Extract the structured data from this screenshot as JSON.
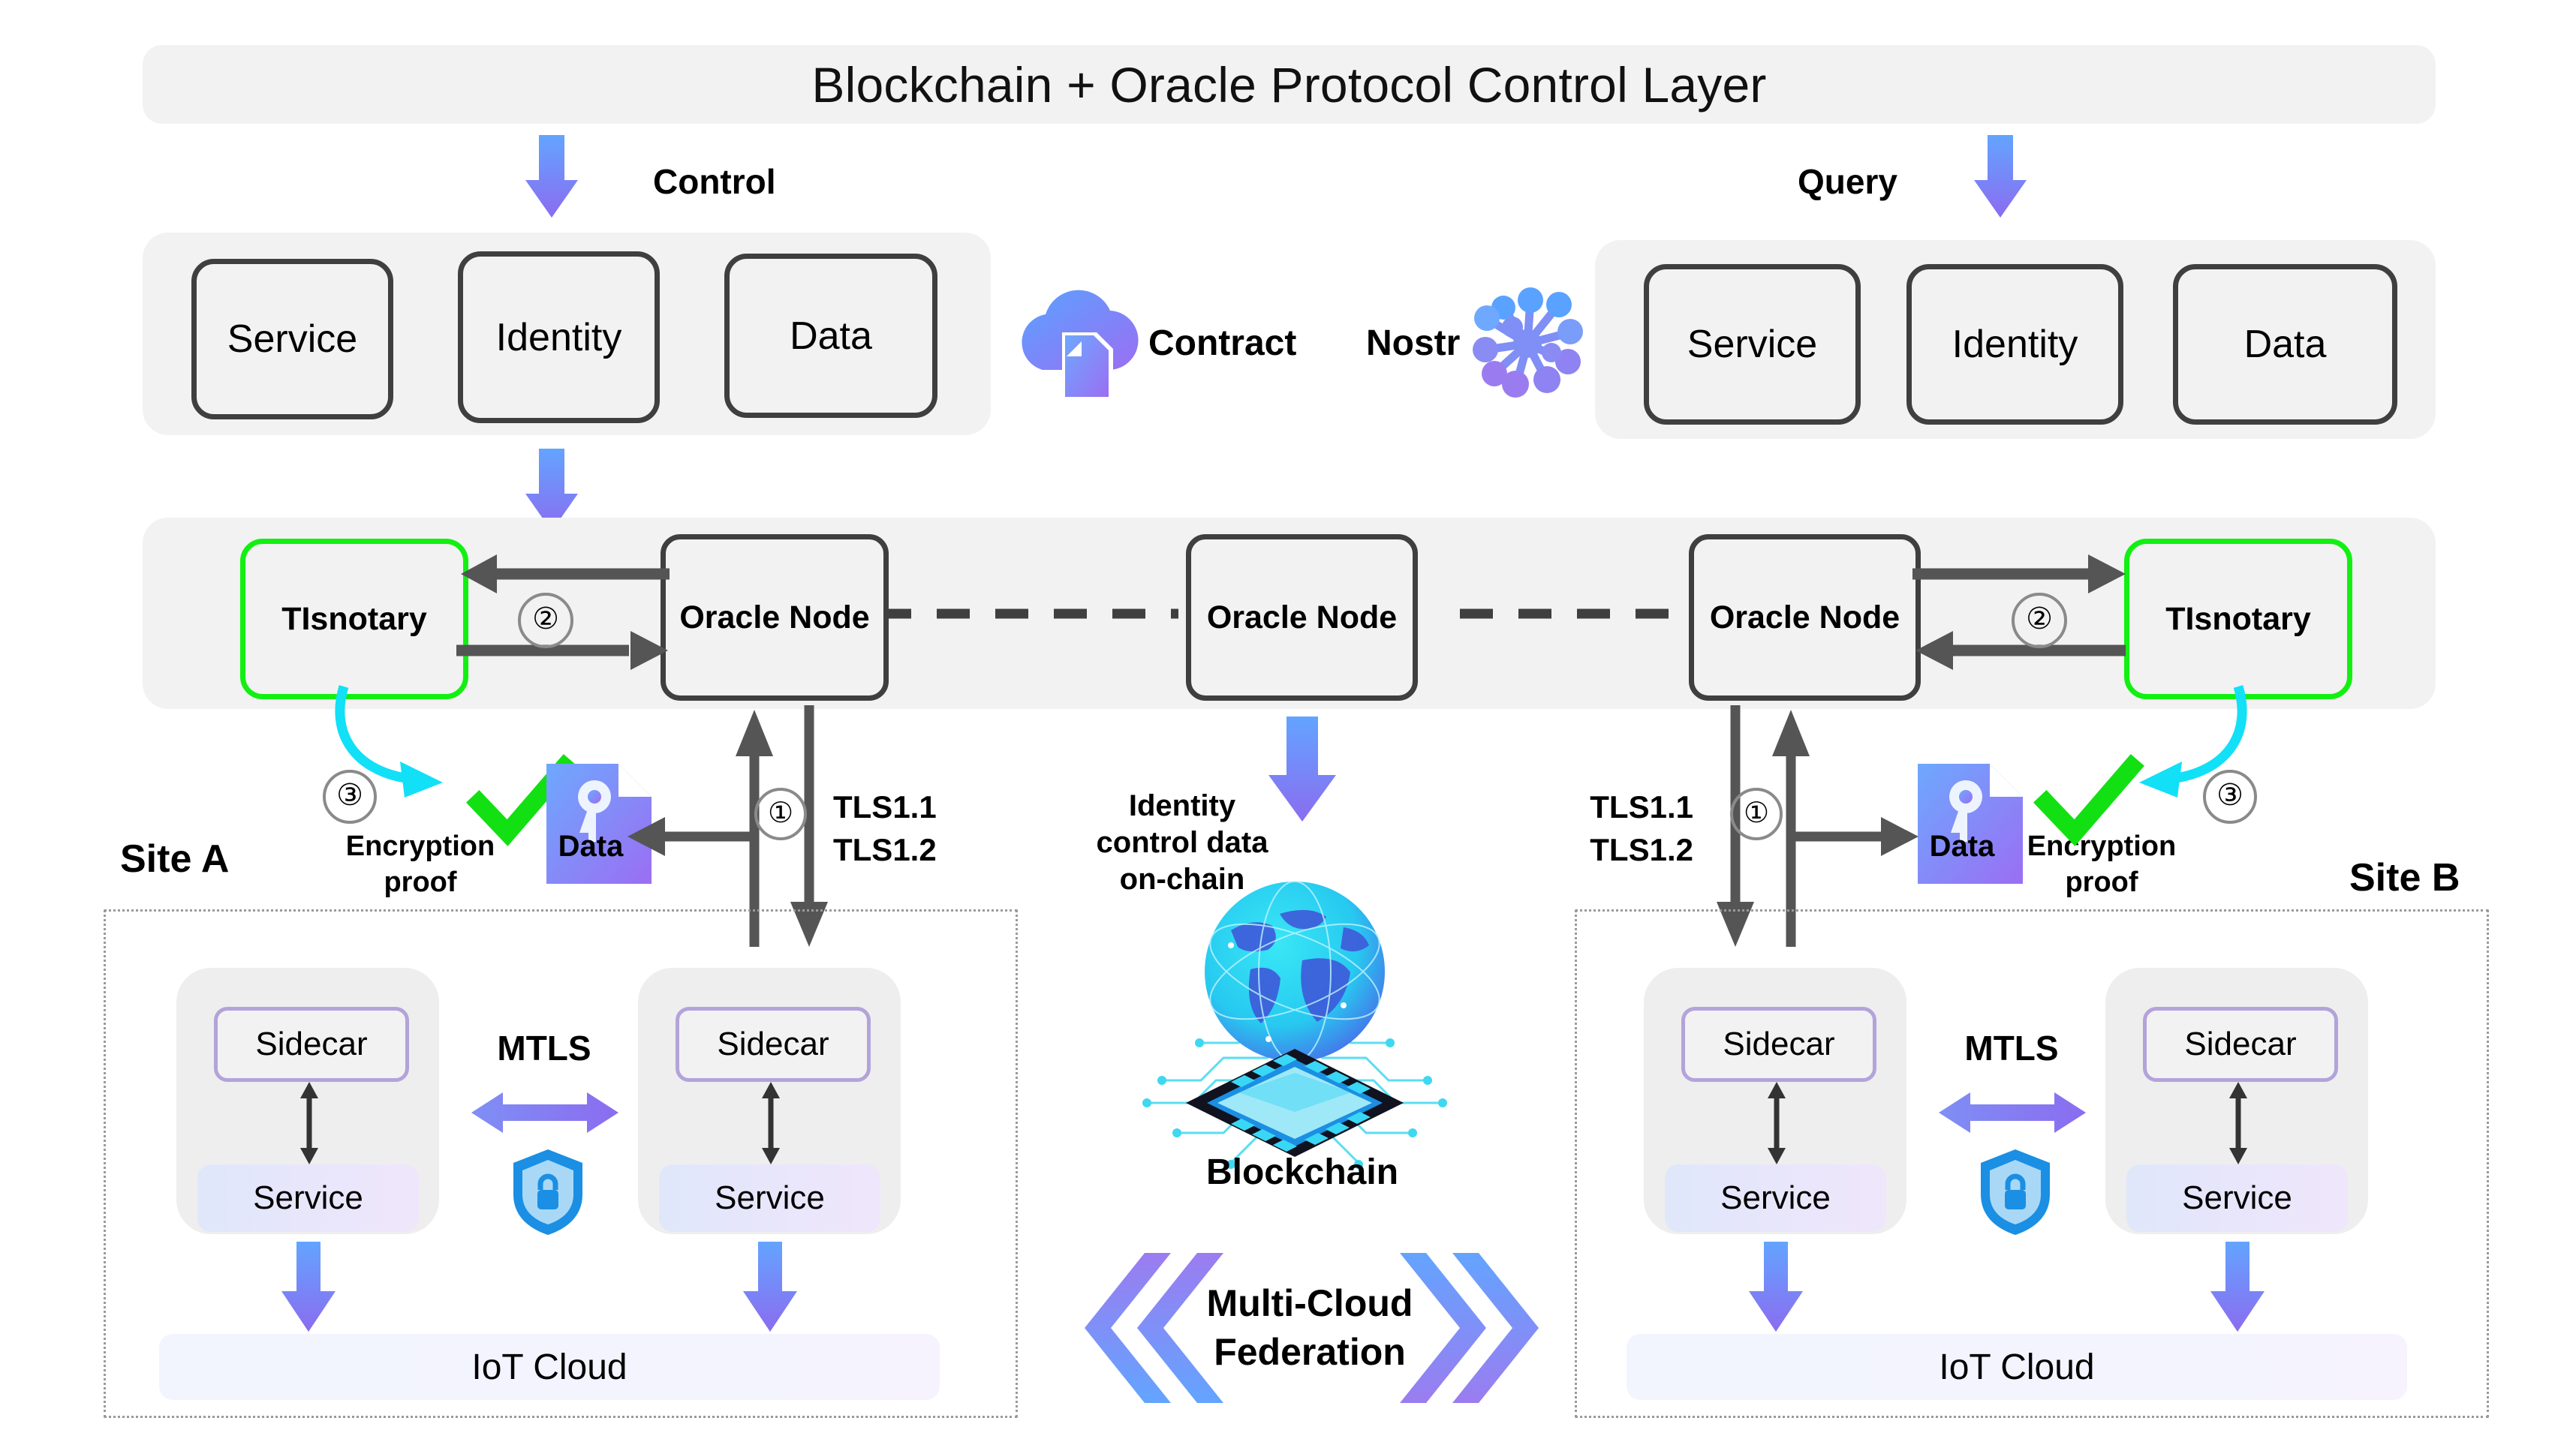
{
  "title": "Blockchain + Oracle Protocol Control Layer",
  "colors": {
    "panel_bg": "#f2f2f2",
    "box_border": "#3f3f3f",
    "notary_border": "#12f012",
    "arrow_purple_top": "#63a4ff",
    "arrow_purple_bottom": "#8b6cf0",
    "arrow_gray": "#555555",
    "cyan": "#11e0f7",
    "check_green": "#12e012",
    "sidecar_border": "#b3a3da",
    "shield_blue": "#1a8fe3"
  },
  "flow_labels": {
    "control": "Control",
    "query": "Query"
  },
  "left_panel": {
    "items": [
      "Service",
      "Identity",
      "Data"
    ]
  },
  "right_panel": {
    "items": [
      "Service",
      "Identity",
      "Data"
    ]
  },
  "middle_icons": {
    "contract_label": "Contract",
    "contract_icon": "cloud-document-icon",
    "nostr_label": "Nostr",
    "nostr_icon": "network-nodes-icon"
  },
  "oracle_row": {
    "notary_left": "TIsnotary",
    "notary_right": "TIsnotary",
    "nodes": [
      "Oracle Node",
      "Oracle Node",
      "Oracle Node"
    ],
    "step_left": "②",
    "step_right": "②"
  },
  "site_a": {
    "label": "Site A",
    "step_three": "③",
    "encryption_proof": "Encryption\nproof",
    "encryption_proof_line1": "Encryption",
    "encryption_proof_line2": "proof",
    "check_icon": "green-check-icon",
    "data_icon": "data-key-file-icon",
    "data_label": "Data",
    "step_one": "①",
    "tls_line1": "TLS1.1",
    "tls_line2": "TLS1.2",
    "mtls_label": "MTLS",
    "shield_icon": "shield-lock-icon",
    "pods": [
      {
        "sidecar": "Sidecar",
        "service": "Service"
      },
      {
        "sidecar": "Sidecar",
        "service": "Service"
      }
    ],
    "iot_cloud": "IoT  Cloud"
  },
  "site_b": {
    "label": "Site B",
    "step_three": "③",
    "encryption_proof_line1": "Encryption",
    "encryption_proof_line2": "proof",
    "check_icon": "green-check-icon",
    "data_icon": "data-key-file-icon",
    "data_label": "Data",
    "step_one": "①",
    "tls_line1": "TLS1.1",
    "tls_line2": "TLS1.2",
    "mtls_label": "MTLS",
    "shield_icon": "shield-lock-icon",
    "pods": [
      {
        "sidecar": "Sidecar",
        "service": "Service"
      },
      {
        "sidecar": "Sidecar",
        "service": "Service"
      }
    ],
    "iot_cloud": "IoT Cloud"
  },
  "center": {
    "identity_line1": "Identity",
    "identity_line2": "control data",
    "identity_line3": "on-chain",
    "blockchain_label": "Blockchain",
    "blockchain_icon": "globe-chip-icon",
    "federation_line1": "Multi-Cloud",
    "federation_line2": "Federation",
    "chevron_left_icon": "double-chevron-left-icon",
    "chevron_right_icon": "double-chevron-right-icon"
  }
}
